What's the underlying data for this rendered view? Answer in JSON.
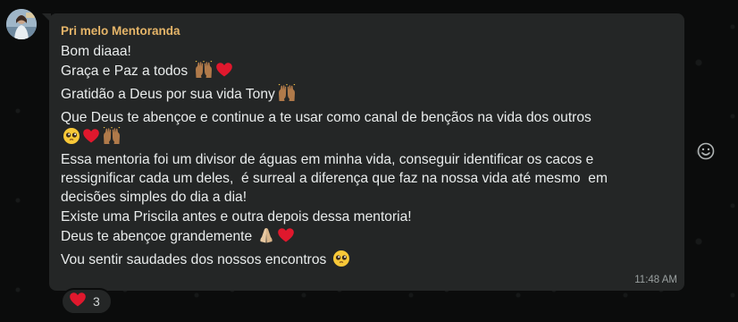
{
  "message": {
    "sender": "Pri melo Mentoranda",
    "time": "11:48 AM",
    "lines": [
      {
        "text": "Bom diaaa!",
        "emojis": []
      },
      {
        "text": "Graça e Paz a todos ",
        "emojis": [
          "raising-hands-icon",
          "red-heart-icon"
        ]
      },
      {
        "text": "Gratidão a Deus por sua vida Tony",
        "emojis": [
          "raising-hands-icon"
        ]
      },
      {
        "text": "Que Deus te abençoe e continue a te usar como canal de bençãos na vida dos outros",
        "emojis": []
      },
      {
        "text": "",
        "emojis": [
          "pleading-face-icon",
          "red-heart-icon",
          "raising-hands-icon"
        ]
      },
      {
        "text": "Essa mentoria foi um divisor de águas em minha vida, conseguir identificar os cacos e",
        "emojis": []
      },
      {
        "text": "ressignificar cada um deles,  é surreal a diferença que faz na nossa vida até mesmo  em",
        "emojis": []
      },
      {
        "text": "decisões simples do dia a dia!",
        "emojis": []
      },
      {
        "text": "Existe uma Priscila antes e outra depois dessa mentoria!",
        "emojis": []
      },
      {
        "text": "Deus te abençoe grandemente ",
        "emojis": [
          "folded-hands-icon",
          "red-heart-icon"
        ]
      },
      {
        "text": "Vou sentir saudades dos nossos encontros ",
        "emojis": [
          "pleading-face-icon"
        ]
      }
    ]
  },
  "reaction": {
    "emoji": "red-heart-icon",
    "count": "3"
  },
  "icons": {
    "react_button": "smiley-icon"
  },
  "colors": {
    "background": "#0b0c0c",
    "bubble": "#242626",
    "sender": "#e5b569",
    "text": "#e9ecec",
    "timestamp": "#9aa0a0",
    "heart": "#e0182d",
    "skin": "#b07a4a"
  }
}
